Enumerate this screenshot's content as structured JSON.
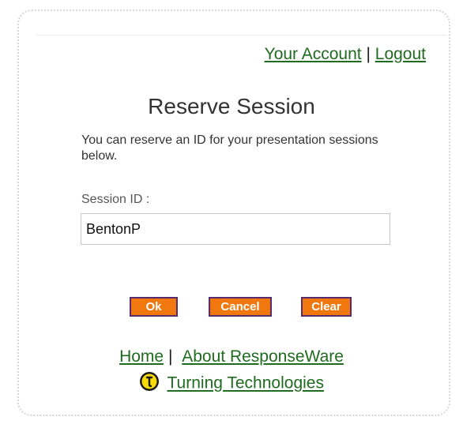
{
  "header": {
    "account_link": "Your Account",
    "separator": "|",
    "logout_link": "Logout"
  },
  "main": {
    "title": "Reserve Session",
    "description": "You can reserve an ID for your presentation sessions below.",
    "session_label": "Session ID :",
    "session_value": "BentonP"
  },
  "actions": {
    "ok_label": "Ok",
    "cancel_label": "Cancel",
    "clear_label": "Clear"
  },
  "footer": {
    "home_link": "Home",
    "separator": "|",
    "about_link": "About ResponseWare",
    "company_link": "Turning Technologies",
    "logo_icon": "turning-technologies-logo-icon"
  },
  "colors": {
    "link": "#1f6b1f",
    "button_bg": "#f0780f",
    "button_border": "#5a2a6e",
    "logo_yellow": "#f5d90a"
  }
}
